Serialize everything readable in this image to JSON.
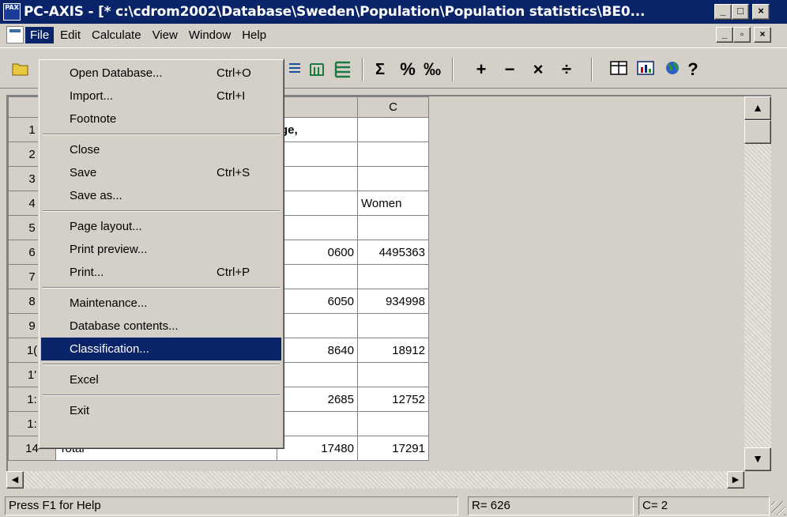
{
  "titlebar": {
    "app_icon": "PAX",
    "title": "PC-AXIS - [* c:\\cdrom2002\\Database\\Sweden\\Population\\Population statistics\\BE0...",
    "minimize": "_",
    "maximize": "□",
    "close": "×"
  },
  "menubar": {
    "items": [
      "File",
      "Edit",
      "Calculate",
      "View",
      "Window",
      "Help"
    ],
    "mdi_min": "_",
    "mdi_restore": "▫",
    "mdi_close": "×"
  },
  "toolbar": {
    "sum": "Σ",
    "percent": "%",
    "permille": "‰",
    "plus": "+",
    "minus": "−",
    "multiply": "×",
    "divide": "÷",
    "help": "?"
  },
  "file_menu": {
    "items": [
      {
        "label": "Open Database...",
        "shortcut": "Ctrl+O"
      },
      {
        "label": "Import...",
        "shortcut": "Ctrl+I"
      },
      {
        "label": "Footnote",
        "shortcut": ""
      },
      {
        "label": "Close",
        "shortcut": ""
      },
      {
        "label": "Save",
        "shortcut": "Ctrl+S"
      },
      {
        "label": "Save as...",
        "shortcut": ""
      },
      {
        "label": "Page layout...",
        "shortcut": ""
      },
      {
        "label": "Print preview...",
        "shortcut": ""
      },
      {
        "label": "Print...",
        "shortcut": "Ctrl+P"
      },
      {
        "label": "Maintenance...",
        "shortcut": ""
      },
      {
        "label": "Database contents...",
        "shortcut": ""
      },
      {
        "label": "Classification...",
        "shortcut": ""
      },
      {
        "label": "Excel",
        "shortcut": ""
      },
      {
        "label": "Exit",
        "shortcut": ""
      }
    ],
    "highlighted": "Classification..."
  },
  "grid": {
    "columns": [
      "",
      "C"
    ],
    "rows": [
      {
        "num": "1",
        "a": "",
        "b": "ge,",
        "c": ""
      },
      {
        "num": "2",
        "a": "",
        "b": "",
        "c": ""
      },
      {
        "num": "3",
        "a": "",
        "b": "",
        "c": ""
      },
      {
        "num": "4",
        "a": "",
        "b": "",
        "c": "Women"
      },
      {
        "num": "5",
        "a": "",
        "b": "",
        "c": ""
      },
      {
        "num": "6",
        "a": "",
        "b": "0600",
        "c": "4495363"
      },
      {
        "num": "7",
        "a": "",
        "b": "",
        "c": ""
      },
      {
        "num": "8",
        "a": "",
        "b": "6050",
        "c": "934998"
      },
      {
        "num": "9",
        "a": "",
        "b": "",
        "c": ""
      },
      {
        "num": "1(",
        "a": "",
        "b": "8640",
        "c": "18912"
      },
      {
        "num": "1'",
        "a": "",
        "b": "",
        "c": ""
      },
      {
        "num": "1:",
        "a": "",
        "b": "2685",
        "c": "12752"
      },
      {
        "num": "1:",
        "a": "",
        "b": "",
        "c": ""
      },
      {
        "num": "14",
        "a": "Total",
        "b": "17480",
        "c": "17291"
      }
    ]
  },
  "scrollbars": {
    "up": "▲",
    "down": "▼",
    "left": "◀",
    "right": "▶"
  },
  "statusbar": {
    "help": "Press F1 for Help",
    "row": "R= 626",
    "col": "C= 2"
  },
  "colors": {
    "title_bg": "#0a246a",
    "face": "#d4d0c8",
    "highlight": "#0a246a"
  }
}
